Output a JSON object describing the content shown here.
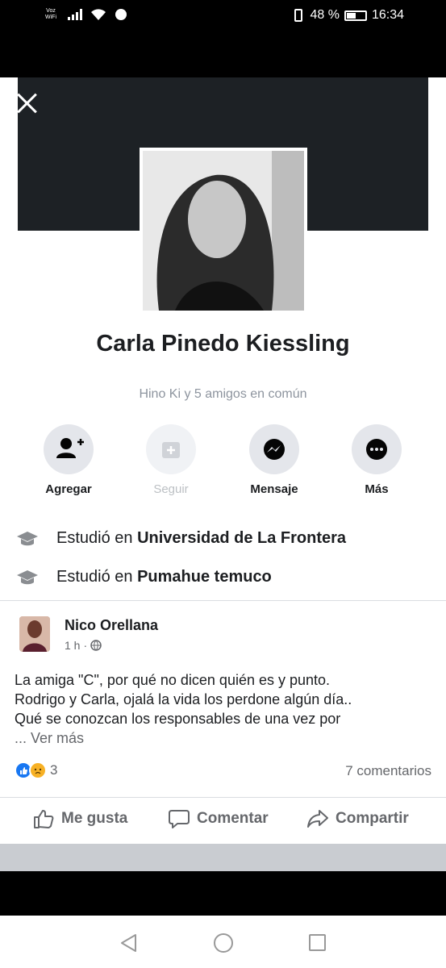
{
  "status_bar": {
    "volte": "Voz WiFi",
    "battery": "48 %",
    "time": "16:34"
  },
  "profile": {
    "name": "Carla Pinedo Kiessling",
    "mutual_friends": "Hino Ki y 5 amigos en común"
  },
  "actions": [
    {
      "label": "Agregar",
      "icon": "add-friend-icon"
    },
    {
      "label": "Seguir",
      "icon": "follow-icon"
    },
    {
      "label": "Mensaje",
      "icon": "messenger-icon"
    },
    {
      "label": "Más",
      "icon": "more-icon"
    }
  ],
  "education": [
    {
      "prefix": "Estudió en",
      "school": "Universidad de La Frontera"
    },
    {
      "prefix": "Estudió en",
      "school": "Pumahue temuco"
    }
  ],
  "post": {
    "author": "Nico Orellana",
    "time": "1 h",
    "text_lines": [
      "La amiga \"C\", por qué no dicen quién es y punto.",
      "Rodrigo y Carla, ojalá la vida los perdone algún día..",
      "Qué se conozcan los responsables de una vez por"
    ],
    "see_more": "... Ver más",
    "reaction_count": "3",
    "comments": "7 comentarios",
    "like_label": "Me gusta",
    "comment_label": "Comentar",
    "share_label": "Compartir"
  }
}
